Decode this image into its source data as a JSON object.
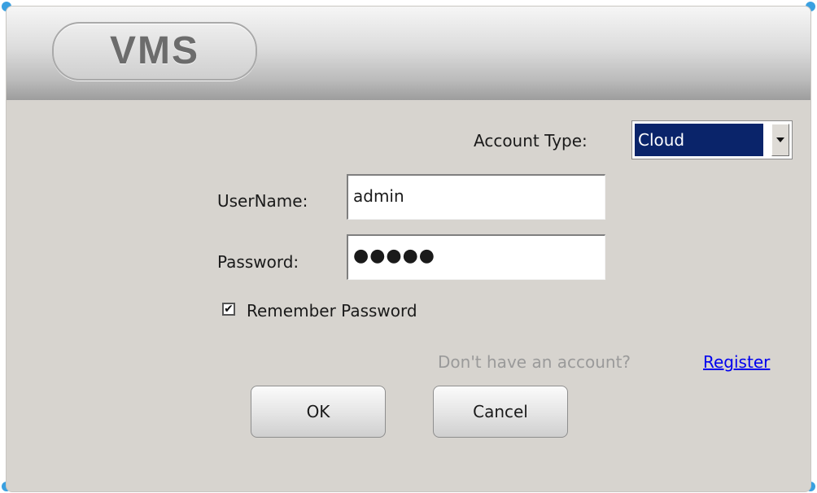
{
  "window": {
    "logo_text": "VMS",
    "accent_color": "#3aa0e0"
  },
  "account_type": {
    "label": "Account Type:",
    "selected": "Cloud"
  },
  "username": {
    "label": "UserName:",
    "value": "admin"
  },
  "password": {
    "label": "Password:",
    "masked_value": "●●●●●"
  },
  "remember": {
    "label": "Remember Password",
    "checked": true,
    "check_glyph": "✔"
  },
  "register": {
    "prompt": "Don't have an account?",
    "link": "Register"
  },
  "buttons": {
    "ok": "OK",
    "cancel": "Cancel"
  },
  "icons": {
    "dropdown": "chevron-down-icon",
    "checkbox": "check-icon"
  }
}
